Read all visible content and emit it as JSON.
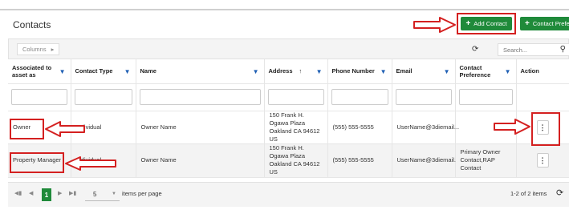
{
  "page": {
    "title": "Contacts"
  },
  "header": {
    "add_contact_label": "Add Contact",
    "contact_preferences_label": "Contact Preferences"
  },
  "toolbar": {
    "columns_label": "Columns",
    "search_placeholder": "Search..."
  },
  "table": {
    "headers": {
      "associated": "Associated to asset as",
      "contact_type": "Contact Type",
      "name": "Name",
      "address": "Address",
      "phone": "Phone Number",
      "email": "Email",
      "preference": "Contact Preference",
      "action": "Action"
    },
    "rows": [
      {
        "associated": "Owner",
        "contact_type": "Individual",
        "name": "Owner Name",
        "address": "150 Frank H. Ogawa Plaza Oakland CA 94612 US",
        "phone": "(555) 555-5555",
        "email": "UserName@3diemail...",
        "preference": ""
      },
      {
        "associated": "Property Manager",
        "contact_type": "Individual",
        "name": "Owner Name",
        "address": "150 Frank H. Ogawa Plaza Oakland CA 94612 US",
        "phone": "(555) 555-5555",
        "email": "UserName@3diemail...",
        "preference": "Primary Owner Contact,RAP Contact"
      }
    ]
  },
  "pager": {
    "current_page": "1",
    "page_size": "5",
    "per_page_label": "items per page",
    "items_count": "1-2 of 2 items"
  },
  "colors": {
    "accent": "#1f8a3a",
    "annotation": "#d42020",
    "filter_icon": "#1e5fb4"
  },
  "icons": [
    "refresh-icon",
    "search-icon",
    "filter-icon",
    "sort-up-icon",
    "kebab-menu-icon",
    "first-page-icon",
    "prev-page-icon",
    "next-page-icon",
    "last-page-icon"
  ]
}
